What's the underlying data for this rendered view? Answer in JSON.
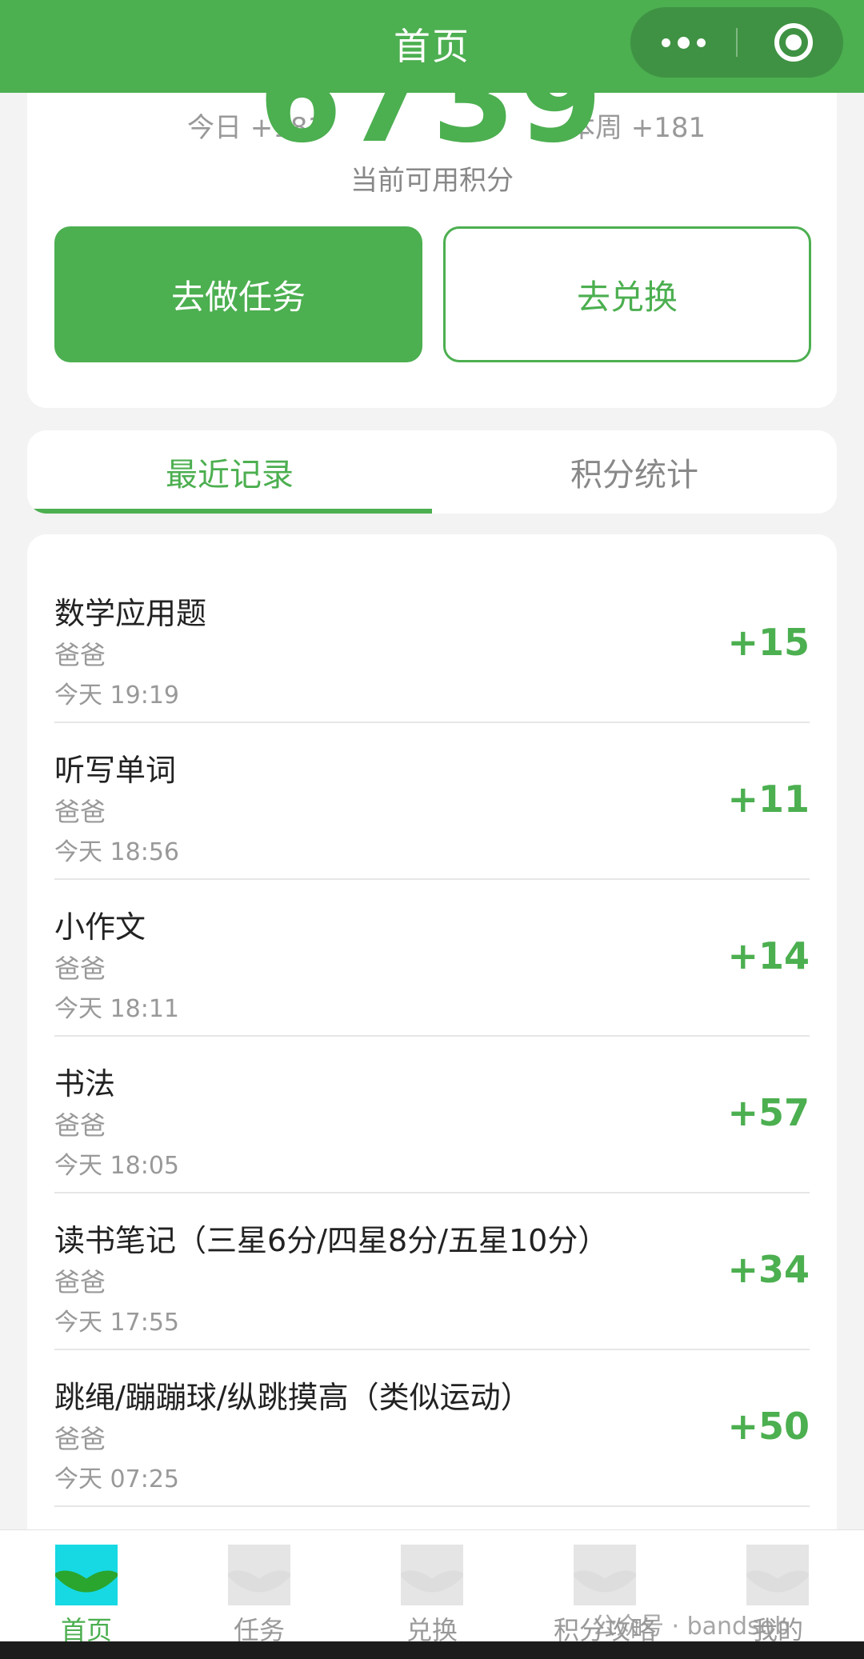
{
  "header": {
    "title": "首页"
  },
  "summary": {
    "today_label": "今日 +181",
    "week_label": "本周 +181",
    "points": "6739",
    "points_caption": "当前可用积分",
    "do_task_label": "去做任务",
    "exchange_label": "去兑换"
  },
  "tabs": [
    {
      "label": "最近记录",
      "active": true
    },
    {
      "label": "积分统计",
      "active": false
    }
  ],
  "records": [
    {
      "title": "数学应用题",
      "by": "爸爸",
      "time": "今天 19:19",
      "points": "+15"
    },
    {
      "title": "听写单词",
      "by": "爸爸",
      "time": "今天 18:56",
      "points": "+11"
    },
    {
      "title": "小作文",
      "by": "爸爸",
      "time": "今天 18:11",
      "points": "+14"
    },
    {
      "title": "书法",
      "by": "爸爸",
      "time": "今天 18:05",
      "points": "+57"
    },
    {
      "title": "读书笔记（三星6分/四星8分/五星10分）",
      "by": "爸爸",
      "time": "今天 17:55",
      "points": "+34"
    },
    {
      "title": "跳绳/蹦蹦球/纵跳摸高（类似运动）",
      "by": "爸爸",
      "time": "今天 07:25",
      "points": "+50"
    }
  ],
  "tabbar": [
    {
      "label": "首页",
      "icon": "home-icon",
      "active": true
    },
    {
      "label": "任务",
      "icon": "task-icon",
      "active": false
    },
    {
      "label": "兑换",
      "icon": "exchange-icon",
      "active": false
    },
    {
      "label": "积分攻略",
      "icon": "guide-icon",
      "active": false
    },
    {
      "label": "我的",
      "icon": "profile-icon",
      "active": false
    }
  ],
  "watermark": "公众号 · bandsob",
  "colors": {
    "brand_green": "#4caf50",
    "active_icon_bg": "#16d9e3"
  }
}
